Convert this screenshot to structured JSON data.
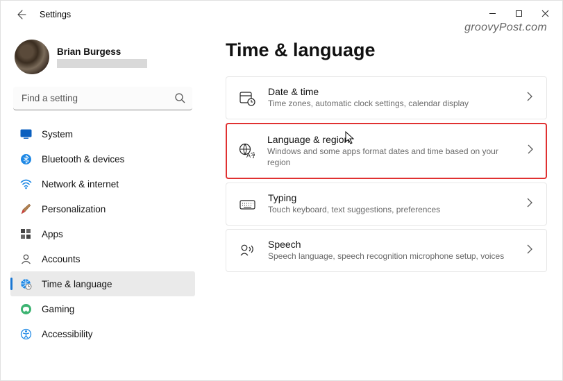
{
  "window": {
    "title": "Settings"
  },
  "watermark": "groovyPost.com",
  "profile": {
    "name": "Brian Burgess"
  },
  "search": {
    "placeholder": "Find a setting"
  },
  "nav": {
    "items": [
      {
        "label": "System"
      },
      {
        "label": "Bluetooth & devices"
      },
      {
        "label": "Network & internet"
      },
      {
        "label": "Personalization"
      },
      {
        "label": "Apps"
      },
      {
        "label": "Accounts"
      },
      {
        "label": "Time & language"
      },
      {
        "label": "Gaming"
      },
      {
        "label": "Accessibility"
      }
    ]
  },
  "main": {
    "heading": "Time & language",
    "cards": [
      {
        "title": "Date & time",
        "sub": "Time zones, automatic clock settings, calendar display"
      },
      {
        "title": "Language & region",
        "sub": "Windows and some apps format dates and time based on your region"
      },
      {
        "title": "Typing",
        "sub": "Touch keyboard, text suggestions, preferences"
      },
      {
        "title": "Speech",
        "sub": "Speech language, speech recognition microphone setup, voices"
      }
    ]
  }
}
